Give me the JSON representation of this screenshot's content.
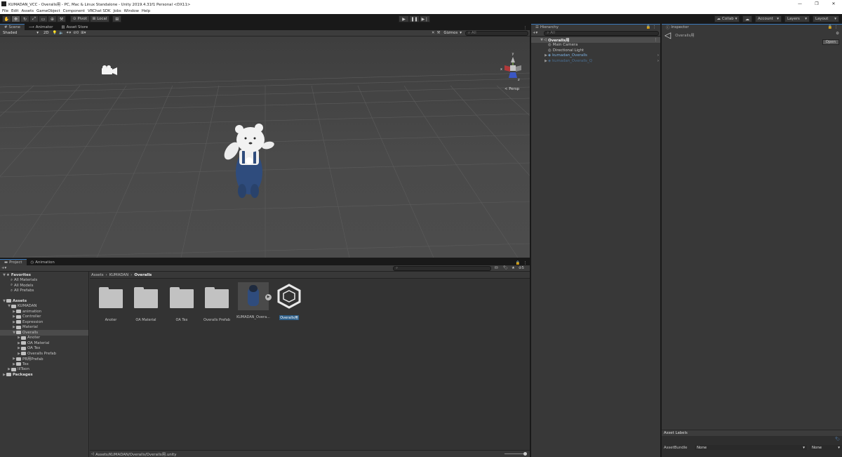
{
  "window": {
    "title": "KUMADAN_VCC - Overalls用 - PC, Mac & Linux Standalone - Unity 2019.4.31f1 Personal <DX11>",
    "controls": [
      "—",
      "❐",
      "✕"
    ]
  },
  "menu": [
    "File",
    "Edit",
    "Assets",
    "GameObject",
    "Component",
    "VRChat SDK",
    "Jobs",
    "Window",
    "Help"
  ],
  "toolbar": {
    "pivot": "Pivot",
    "local": "Local",
    "collab": "Collab",
    "account": "Account",
    "layers": "Layers",
    "layout": "Layout"
  },
  "scene": {
    "tabs": [
      {
        "label": "Scene",
        "icon": "scene-icon"
      },
      {
        "label": "Animator",
        "icon": "animator-icon"
      },
      {
        "label": "Asset Store",
        "icon": "store-icon"
      }
    ],
    "shading": "Shaded",
    "mode2d": "2D",
    "gizmos": "Gizmos",
    "search_placeholder": "All",
    "persp": "< Persp",
    "axis": {
      "y": "y",
      "x": "x",
      "z": "z"
    }
  },
  "hierarchy": {
    "title": "Hierarchy",
    "search_placeholder": "All",
    "scene_name": "Overalls用",
    "items": [
      {
        "label": "Main Camera",
        "indent": 2,
        "color": "#c4c4c4"
      },
      {
        "label": "Directional Light",
        "indent": 2,
        "color": "#c4c4c4"
      },
      {
        "label": "kumadan_Overalls",
        "indent": 1,
        "color": "#7bafe0"
      },
      {
        "label": "kumadan_Overalls_Q",
        "indent": 1,
        "color": "#4a6f93"
      }
    ]
  },
  "inspector": {
    "title": "Inspector",
    "object_name": "Overalls用",
    "open_button": "Open",
    "asset_labels": "Asset Labels",
    "assetbundle_label": "AssetBundle",
    "assetbundle_value": "None",
    "variant_value": "None"
  },
  "project": {
    "tabs": [
      {
        "label": "Project"
      },
      {
        "label": "Animation"
      }
    ],
    "favorites": {
      "title": "Favorites",
      "items": [
        "All Materials",
        "All Models",
        "All Prefabs"
      ]
    },
    "assets_root": "Assets",
    "tree": [
      {
        "label": "KUMADAN",
        "indent": 1,
        "expanded": true
      },
      {
        "label": "animation",
        "indent": 2
      },
      {
        "label": "Controller",
        "indent": 2
      },
      {
        "label": "Expression",
        "indent": 2
      },
      {
        "label": "Material",
        "indent": 2
      },
      {
        "label": "Overalls",
        "indent": 2,
        "selected": true,
        "expanded": true
      },
      {
        "label": "Anoter",
        "indent": 3
      },
      {
        "label": "OA Material",
        "indent": 3
      },
      {
        "label": "OA Tex",
        "indent": 3
      },
      {
        "label": "Overalls Prefab",
        "indent": 3
      },
      {
        "label": "PB用Prefab",
        "indent": 2
      },
      {
        "label": "Tex",
        "indent": 2
      },
      {
        "label": "lilToon",
        "indent": 1
      }
    ],
    "packages": "Packages",
    "breadcrumb": [
      "Assets",
      "KUMADAN",
      "Overalls"
    ],
    "grid_items": [
      "Anoter",
      "OA Material",
      "OA Tex",
      "Overalls Prefab",
      "KUMADAN_Overa...",
      "Overalls用"
    ],
    "status_path": "Assets/KUMADAN/Overalls/Overalls用.unity",
    "visible_count": "5"
  },
  "colors": {
    "accent": "#3a79bb",
    "selection": "#2c5d87"
  }
}
